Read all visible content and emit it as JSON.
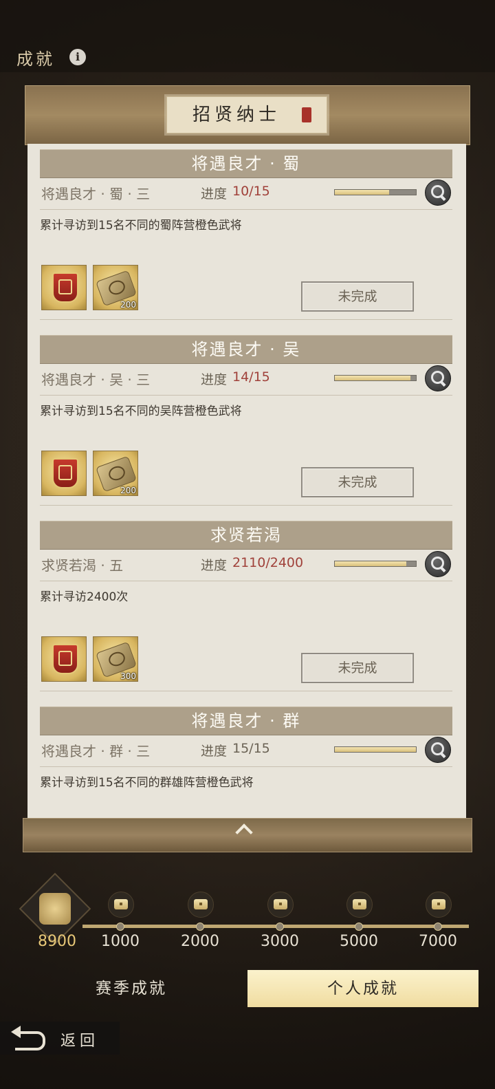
{
  "header": {
    "title": "成就",
    "info_icon": "i"
  },
  "panel": {
    "title": "招贤纳士"
  },
  "cards": [
    {
      "section": "将遇良才 · 蜀",
      "name": "将遇良才 · 蜀 · 三",
      "progress_label": "进度",
      "progress": "10/15",
      "progress_fraction": 0.667,
      "description": "累计寻访到15名不同的蜀阵营橙色武将",
      "rewards": [
        {
          "icon": "badge-icon",
          "qty": ""
        },
        {
          "icon": "scroll-icon",
          "qty": "200"
        }
      ],
      "status": "未完成"
    },
    {
      "section": "将遇良才 · 吴",
      "name": "将遇良才 · 吴 · 三",
      "progress_label": "进度",
      "progress": "14/15",
      "progress_fraction": 0.933,
      "description": "累计寻访到15名不同的吴阵营橙色武将",
      "rewards": [
        {
          "icon": "badge-icon",
          "qty": ""
        },
        {
          "icon": "scroll-icon",
          "qty": "200"
        }
      ],
      "status": "未完成"
    },
    {
      "section": "求贤若渴",
      "name": "求贤若渴 · 五",
      "progress_label": "进度",
      "progress": "2110/2400",
      "progress_fraction": 0.879,
      "description": "累计寻访2400次",
      "rewards": [
        {
          "icon": "badge-icon",
          "qty": ""
        },
        {
          "icon": "scroll-icon",
          "qty": "300"
        }
      ],
      "status": "未完成"
    },
    {
      "section": "将遇良才 · 群",
      "name": "将遇良才 · 群 · 三",
      "progress_label": "进度",
      "progress": "15/15",
      "progress_fraction": 1.0,
      "description": "累计寻访到15名不同的群雄阵营橙色武将"
    }
  ],
  "milestones": {
    "current": "8900",
    "steps": [
      "1000",
      "2000",
      "3000",
      "5000",
      "7000"
    ]
  },
  "tabs": {
    "season": "赛季成就",
    "personal": "个人成就",
    "active": "personal"
  },
  "back": {
    "label": "返回"
  },
  "colors": {
    "accent": "#f0dca0",
    "progress_red": "#a0413a",
    "parchment": "#e8e4da"
  }
}
